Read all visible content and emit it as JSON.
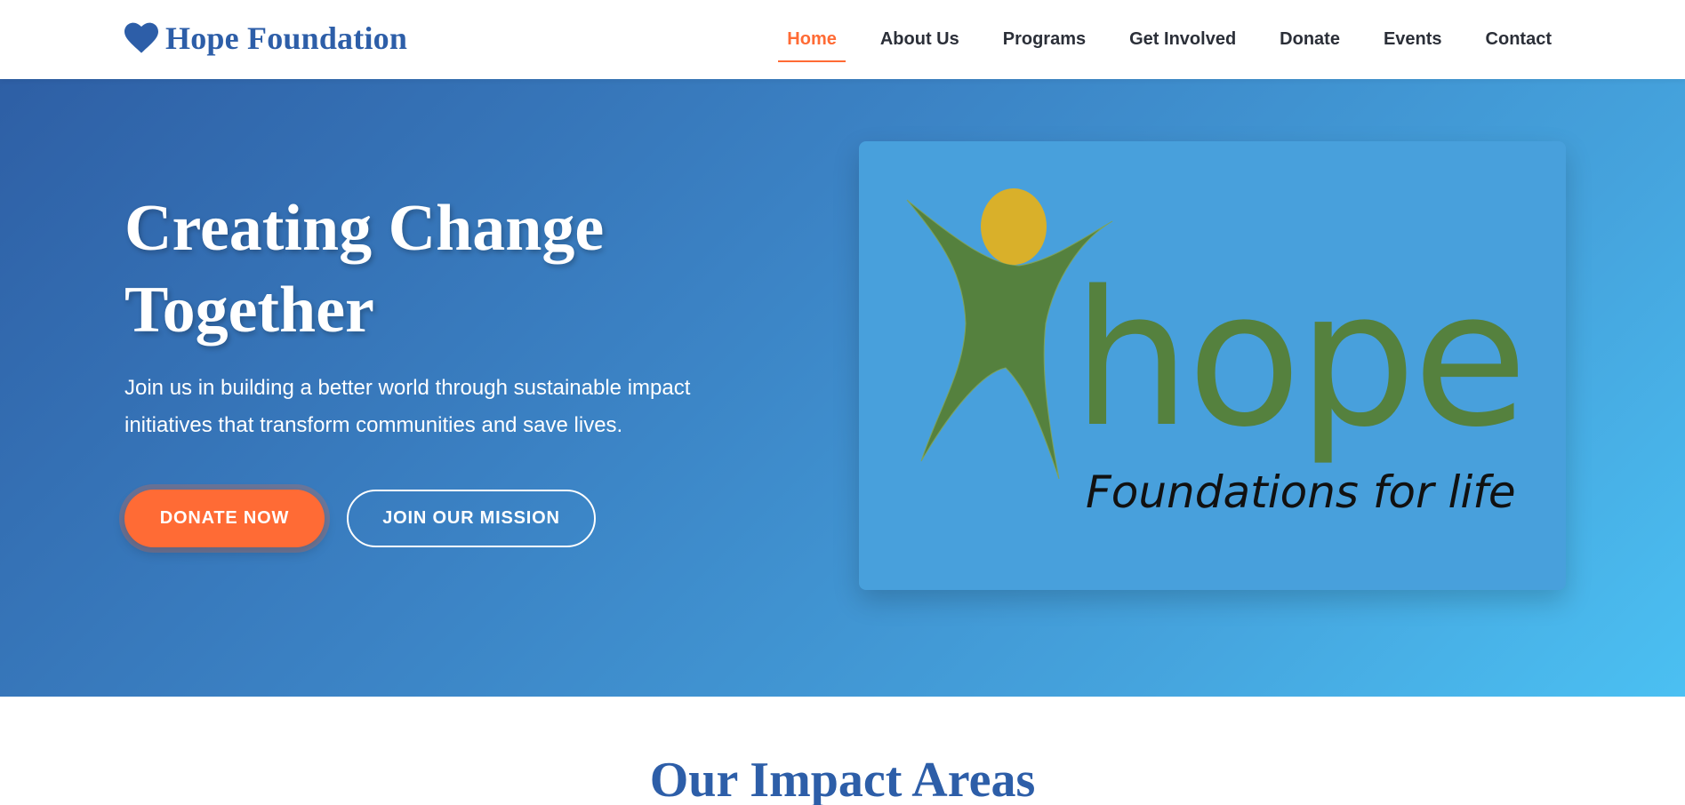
{
  "header": {
    "brand_name": "Hope Foundation",
    "brand_icon": "heart-icon",
    "nav": [
      {
        "label": "Home",
        "active": true
      },
      {
        "label": "About Us",
        "active": false
      },
      {
        "label": "Programs",
        "active": false
      },
      {
        "label": "Get Involved",
        "active": false
      },
      {
        "label": "Donate",
        "active": false
      },
      {
        "label": "Events",
        "active": false
      },
      {
        "label": "Contact",
        "active": false
      }
    ]
  },
  "hero": {
    "title_line1": "Creating Change",
    "title_line2": "Together",
    "subtitle": "Join us in building a better world through sustainable impact initiatives that transform communities and save lives.",
    "donate_button": "DONATE NOW",
    "join_button": "JOIN OUR MISSION",
    "logo": {
      "word": "hope",
      "tagline": "Foundations for life"
    }
  },
  "impact": {
    "title": "Our Impact Areas"
  },
  "colors": {
    "brand_blue": "#2d5ea8",
    "accent_orange": "#ff6b35",
    "logo_green": "#55813e",
    "logo_yellow": "#d9b02a"
  }
}
